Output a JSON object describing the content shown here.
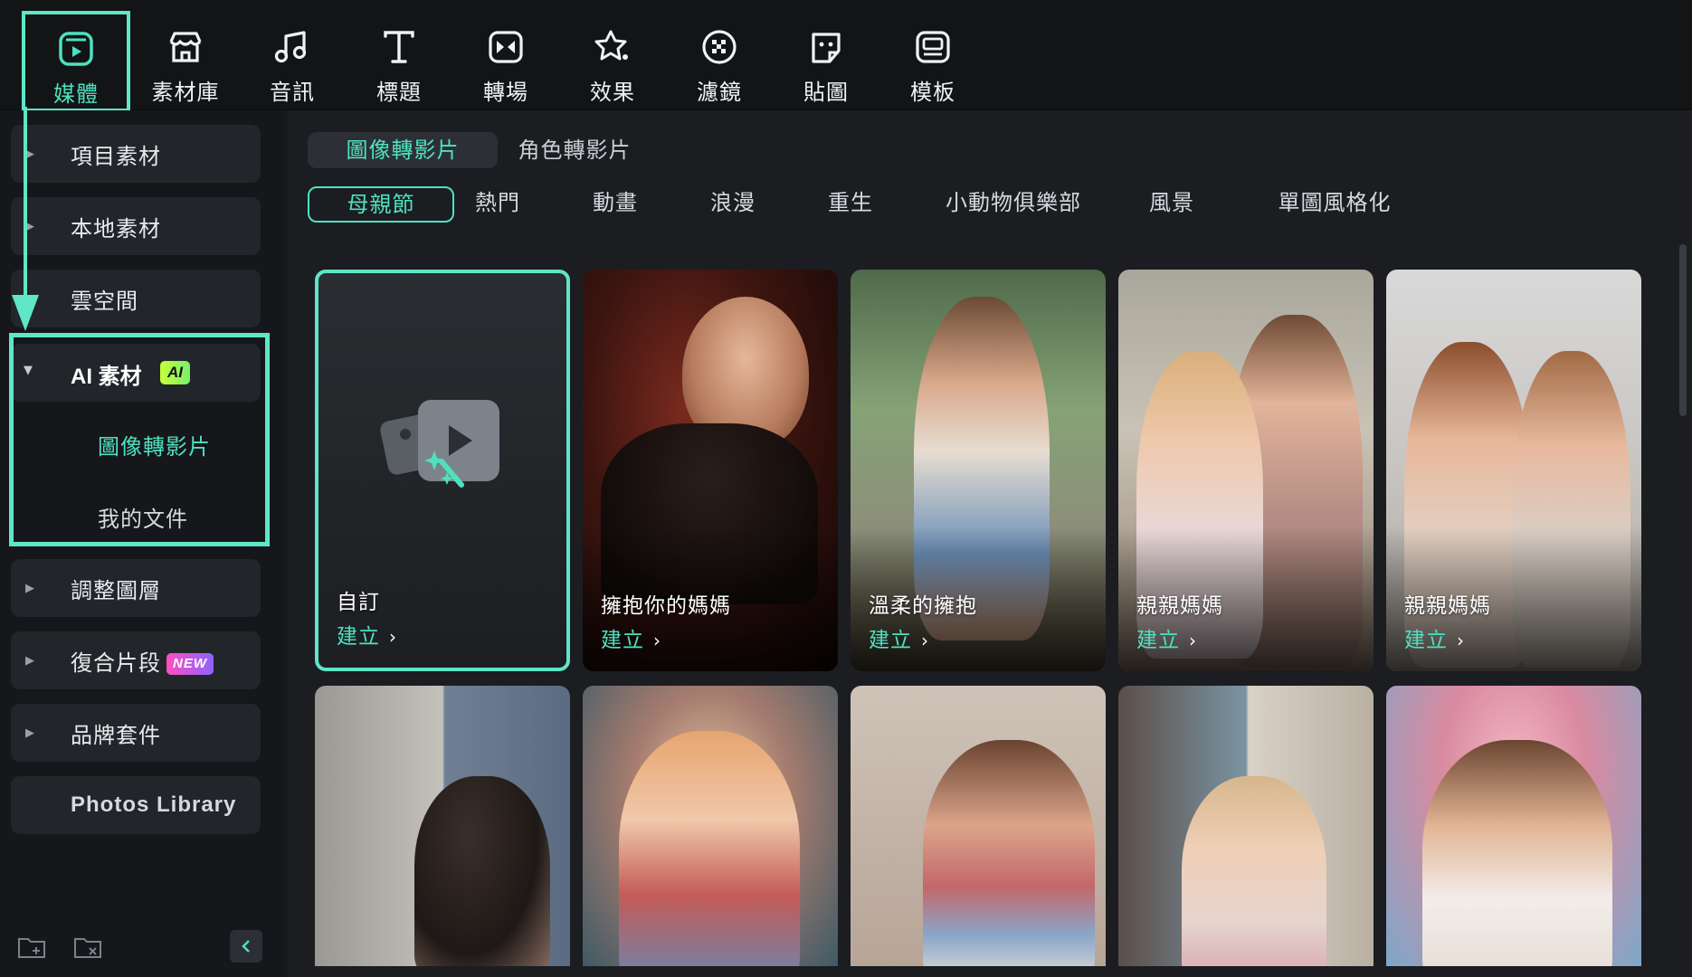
{
  "toolbar": {
    "items": [
      {
        "label": "媒體",
        "icon": "media-icon"
      },
      {
        "label": "素材庫",
        "icon": "store-icon"
      },
      {
        "label": "音訊",
        "icon": "music-icon"
      },
      {
        "label": "標題",
        "icon": "title-icon"
      },
      {
        "label": "轉場",
        "icon": "transition-icon"
      },
      {
        "label": "效果",
        "icon": "effects-icon"
      },
      {
        "label": "濾鏡",
        "icon": "filter-icon"
      },
      {
        "label": "貼圖",
        "icon": "sticker-icon"
      },
      {
        "label": "模板",
        "icon": "template-icon"
      }
    ],
    "active_index": 0
  },
  "sidebar": {
    "items": [
      {
        "label": "項目素材"
      },
      {
        "label": "本地素材"
      },
      {
        "label": "雲空間"
      }
    ],
    "ai_group": {
      "label": "AI 素材",
      "badge": "AI",
      "children": [
        {
          "label": "圖像轉影片",
          "active": true
        },
        {
          "label": "我的文件",
          "active": false
        }
      ]
    },
    "items_after": [
      {
        "label": "調整圖層"
      },
      {
        "label": "復合片段",
        "badge": "NEW"
      },
      {
        "label": "品牌套件"
      }
    ],
    "photos_library": "Photos Library"
  },
  "main": {
    "tabs": [
      {
        "label": "圖像轉影片",
        "active": true
      },
      {
        "label": "角色轉影片",
        "active": false
      }
    ],
    "chips": [
      {
        "label": "母親節",
        "active": true
      },
      {
        "label": "熱門"
      },
      {
        "label": "動畫"
      },
      {
        "label": "浪漫"
      },
      {
        "label": "重生"
      },
      {
        "label": "小動物俱樂部"
      },
      {
        "label": "風景"
      },
      {
        "label": "單圖風格化"
      }
    ],
    "cards_row1": [
      {
        "title": "自訂",
        "action": "建立"
      },
      {
        "title": "擁抱你的媽媽",
        "action": "建立"
      },
      {
        "title": "溫柔的擁抱",
        "action": "建立"
      },
      {
        "title": "親親媽媽",
        "action": "建立"
      },
      {
        "title": "親親媽媽",
        "action": "建立"
      }
    ]
  },
  "colors": {
    "accent": "#4fe0c0",
    "highlight_border": "#5ee6c6",
    "background": "#17191c"
  }
}
